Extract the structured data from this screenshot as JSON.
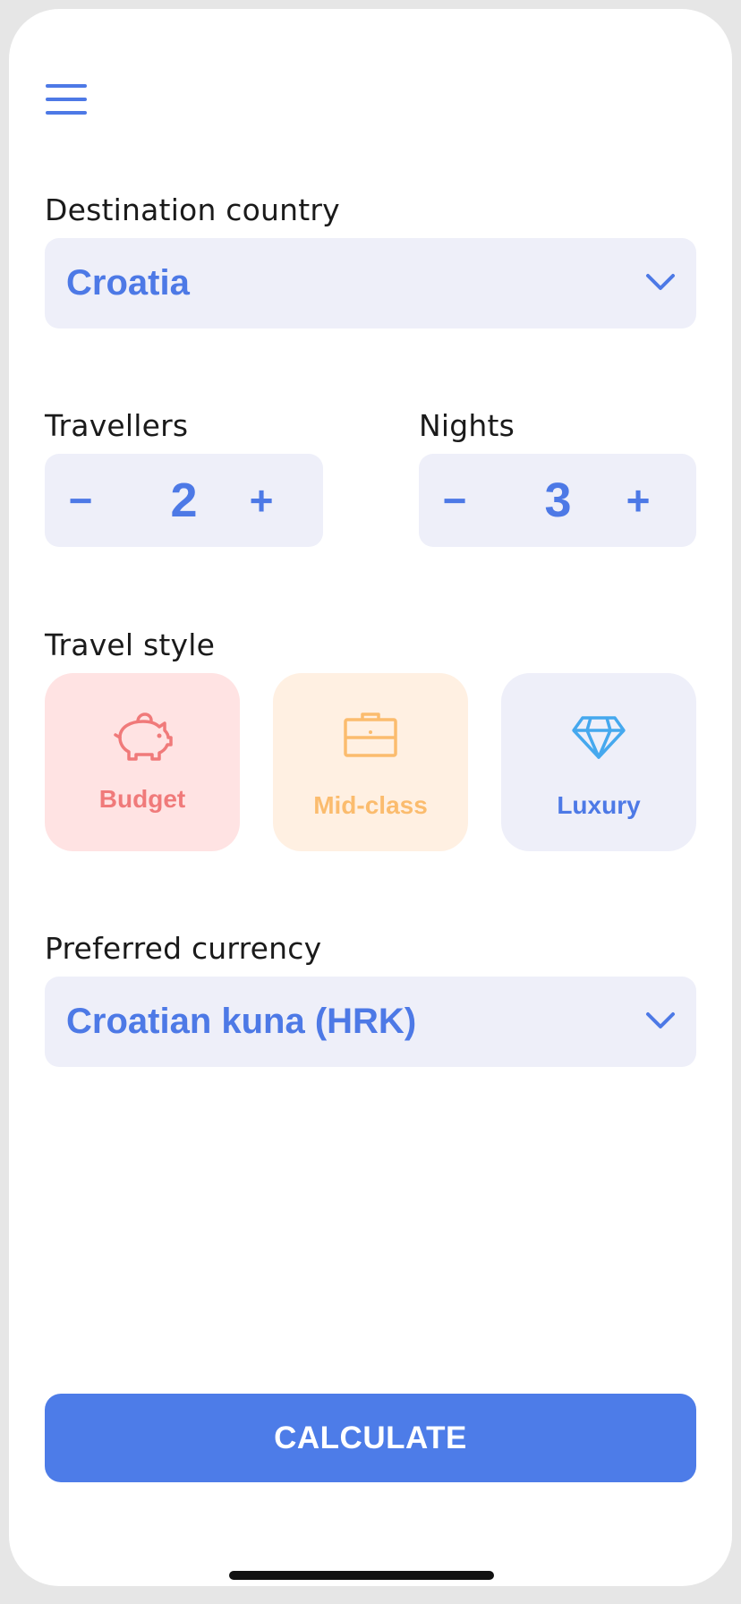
{
  "destination": {
    "label": "Destination country",
    "value": "Croatia"
  },
  "travellers": {
    "label": "Travellers",
    "value": "2",
    "minus": "−",
    "plus": "+"
  },
  "nights": {
    "label": "Nights",
    "value": "3",
    "minus": "−",
    "plus": "+"
  },
  "travel_style": {
    "label": "Travel style",
    "options": [
      {
        "label": "Budget",
        "icon": "piggy-bank-icon",
        "bg": "#ffe3e3",
        "color": "#f07a7a"
      },
      {
        "label": "Mid-class",
        "icon": "briefcase-icon",
        "bg": "#fff0e2",
        "color": "#fbbc6e"
      },
      {
        "label": "Luxury",
        "icon": "diamond-icon",
        "bg": "#eeeff9",
        "color": "#4d79e6"
      }
    ]
  },
  "currency": {
    "label": "Preferred currency",
    "value": "Croatian kuna (HRK)"
  },
  "calculate_label": "CALCULATE",
  "colors": {
    "accent": "#4d79e6",
    "field_bg": "#eeeff9",
    "button_bg": "#4d7ce8"
  }
}
